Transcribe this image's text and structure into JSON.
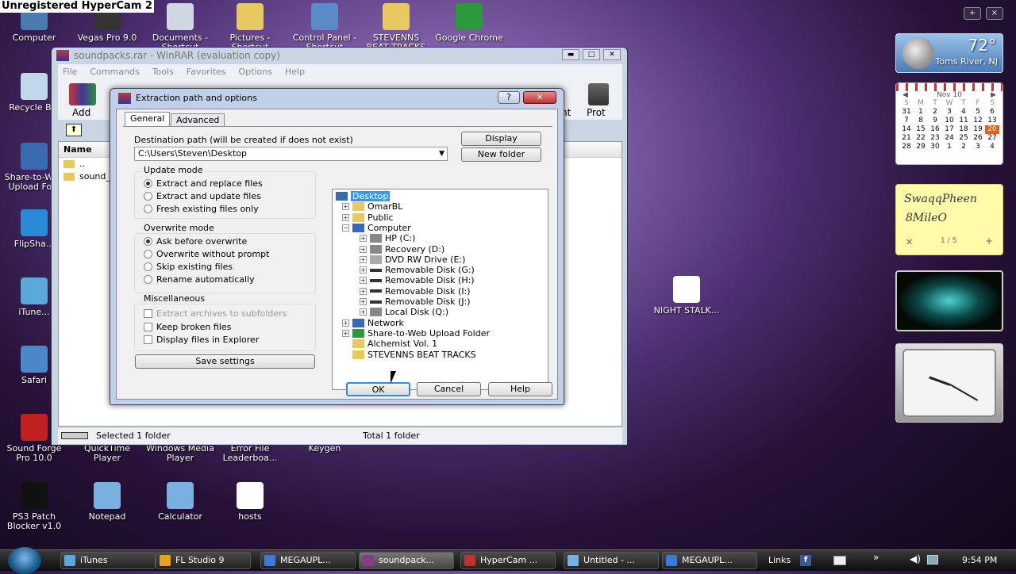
{
  "watermark": "Unregistered HyperCam 2",
  "desktop_icons": [
    {
      "label": "Computer",
      "color": "#4a7ab0"
    },
    {
      "label": "Vegas Pro 9.0",
      "color": "#333"
    },
    {
      "label": "Documents - Shortcut",
      "color": "#cfd7e0"
    },
    {
      "label": "Pictures - Shortcut",
      "color": "#e8c860"
    },
    {
      "label": "Control Panel - Shortcut",
      "color": "#5a8ac8"
    },
    {
      "label": "STEVENNS BEAT TRACKS",
      "color": "#e8c860"
    },
    {
      "label": "Google Chrome",
      "color": "#2a9a3a"
    },
    {
      "label": "Recycle Bin",
      "color": "#c0d8e8"
    },
    {
      "label": "Share-to-Web Upload Fo...",
      "color": "#3a6ab0"
    },
    {
      "label": "FlipSha...",
      "color": "#2a8ad8"
    },
    {
      "label": "iTune...",
      "color": "#5aa8d8"
    },
    {
      "label": "Safari",
      "color": "#4a88c8"
    },
    {
      "label": "Sound Forge Pro 10.0",
      "color": "#c02020"
    },
    {
      "label": "QuickTime Player",
      "color": "#999"
    },
    {
      "label": "Windows Media Player",
      "color": "#999"
    },
    {
      "label": "Error File Leaderboa...",
      "color": "#999"
    },
    {
      "label": "Keygen",
      "color": "#999"
    },
    {
      "label": "PS3 Patch Blocker v1.0",
      "color": "#111"
    },
    {
      "label": "Notepad",
      "color": "#7ab0e0"
    },
    {
      "label": "Calculator",
      "color": "#7ab0e0"
    },
    {
      "label": "hosts",
      "color": "#fff"
    },
    {
      "label": "NIGHT STALK...",
      "color": "#fff"
    }
  ],
  "sidebar": {
    "add": "+",
    "close": "×"
  },
  "weather": {
    "temp": "72°",
    "city": "Toms River, NJ"
  },
  "calendar": {
    "month": "Nov 10",
    "days": [
      "S",
      "M",
      "T",
      "W",
      "T",
      "F",
      "S"
    ],
    "rows": [
      [
        "31",
        "1",
        "2",
        "3",
        "4",
        "5",
        "6"
      ],
      [
        "7",
        "8",
        "9",
        "10",
        "11",
        "12",
        "13"
      ],
      [
        "14",
        "15",
        "16",
        "17",
        "18",
        "19",
        "20"
      ],
      [
        "21",
        "22",
        "23",
        "24",
        "25",
        "26",
        "27"
      ],
      [
        "28",
        "29",
        "30",
        "1",
        "2",
        "3",
        "4"
      ]
    ],
    "today": "20"
  },
  "notes": {
    "line1": "SwaqqPheen",
    "line2": "8MileO",
    "pager": "1 / 5"
  },
  "winrar": {
    "title": "soundpacks.rar - WinRAR (evaluation copy)",
    "menu": [
      "File",
      "Commands",
      "Tools",
      "Favorites",
      "Options",
      "Help"
    ],
    "toolbar": {
      "add": "Add",
      "right": "nt",
      "prot": "Prot"
    },
    "list_header": "Name",
    "rows": [
      "..",
      "sound_"
    ],
    "status_left": "Selected 1 folder",
    "status_right": "Total 1 folder"
  },
  "dialog": {
    "title": "Extraction path and options",
    "tabs": [
      "General",
      "Advanced"
    ],
    "dest_label": "Destination path (will be created if does not exist)",
    "dest_value": "C:\\Users\\Steven\\Desktop",
    "display_btn": "Display",
    "newfolder_btn": "New folder",
    "update_mode": {
      "title": "Update mode",
      "options": [
        "Extract and replace files",
        "Extract and update files",
        "Fresh existing files only"
      ],
      "selected": 0
    },
    "overwrite_mode": {
      "title": "Overwrite mode",
      "options": [
        "Ask before overwrite",
        "Overwrite without prompt",
        "Skip existing files",
        "Rename automatically"
      ],
      "selected": 0
    },
    "misc": {
      "title": "Miscellaneous",
      "options": [
        "Extract archives to subfolders",
        "Keep broken files",
        "Display files in Explorer"
      ]
    },
    "save_btn": "Save settings",
    "tree": [
      {
        "label": "Desktop",
        "level": 0,
        "icon": "desktop-icon",
        "selected": true
      },
      {
        "label": "OmarBL",
        "level": 1,
        "icon": "user-folder-icon"
      },
      {
        "label": "Public",
        "level": 1,
        "icon": "folder-icon"
      },
      {
        "label": "Computer",
        "level": 1,
        "icon": "computer-icon",
        "open": true
      },
      {
        "label": "HP (C:)",
        "level": 2,
        "icon": "drive-icon"
      },
      {
        "label": "Recovery (D:)",
        "level": 2,
        "icon": "drive-icon"
      },
      {
        "label": "DVD RW Drive (E:)",
        "level": 2,
        "icon": "dvd-icon"
      },
      {
        "label": "Removable Disk (G:)",
        "level": 2,
        "icon": "removable-disk-icon"
      },
      {
        "label": "Removable Disk (H:)",
        "level": 2,
        "icon": "removable-disk-icon"
      },
      {
        "label": "Removable Disk (I:)",
        "level": 2,
        "icon": "removable-disk-icon"
      },
      {
        "label": "Removable Disk (J:)",
        "level": 2,
        "icon": "removable-disk-icon"
      },
      {
        "label": "Local Disk (Q:)",
        "level": 2,
        "icon": "drive-icon"
      },
      {
        "label": "Network",
        "level": 1,
        "icon": "network-icon"
      },
      {
        "label": "Share-to-Web Upload Folder",
        "level": 1,
        "icon": "share-folder-icon"
      },
      {
        "label": "Alchemist Vol. 1",
        "level": 1,
        "icon": "folder-icon"
      },
      {
        "label": "STEVENNS BEAT TRACKS",
        "level": 1,
        "icon": "folder-icon"
      }
    ],
    "ok": "OK",
    "cancel": "Cancel",
    "help": "Help"
  },
  "taskbar": {
    "items": [
      {
        "label": "iTunes",
        "color": "#5aa8d8"
      },
      {
        "label": "FL Studio 9",
        "color": "#e8a020"
      },
      {
        "label": "MEGAUPL...",
        "color": "#3a7ad8"
      },
      {
        "label": "soundpack...",
        "color": "#8a3a8a"
      },
      {
        "label": "HyperCam ...",
        "color": "#c03030"
      },
      {
        "label": "Untitled - ...",
        "color": "#7ab0e0"
      },
      {
        "label": "MEGAUPL...",
        "color": "#3a7ad8"
      }
    ],
    "active": 3,
    "links": "Links",
    "time": "9:54 PM"
  }
}
